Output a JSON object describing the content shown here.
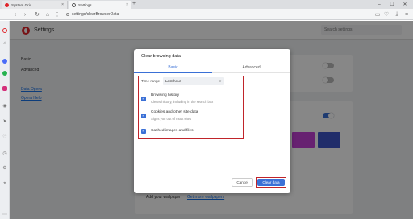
{
  "browser": {
    "tabs": [
      {
        "label": "System Grid"
      },
      {
        "label": "Settings"
      }
    ],
    "new_tab_symbol": "+",
    "url": "settings/clearBrowserData",
    "window_controls": [
      "–",
      "☐",
      "✕"
    ]
  },
  "sidebar_icons": [
    "opera-logo-icon",
    "home-icon",
    "messenger-icon",
    "whatsapp-icon",
    "instagram-icon",
    "camera-icon",
    "send-icon",
    "heart-icon",
    "history-icon",
    "settings-icon",
    "pin-icon"
  ],
  "settings_page": {
    "title": "Settings",
    "search_placeholder": "Search settings",
    "nav": {
      "basic": "Basic",
      "advanced": "Advanced",
      "privacy": "Data Opera",
      "help": "Opera Help"
    },
    "wallpaper_text": "Add your wallpaper",
    "wallpaper_link": "Get more wallpapers"
  },
  "dialog": {
    "title": "Clear browsing data",
    "tabs": {
      "basic": "Basic",
      "advanced": "Advanced"
    },
    "time_range_label": "Time range",
    "time_range_value": "Last hour",
    "options": [
      {
        "title": "Browsing history",
        "desc": "Clears history, including in the search box",
        "checked": true
      },
      {
        "title": "Cookies and other site data",
        "desc": "Signs you out of most sites",
        "checked": true
      },
      {
        "title": "Cached images and files",
        "desc": "",
        "checked": true
      }
    ],
    "cancel_label": "Cancel",
    "clear_label": "Clear data"
  },
  "colors": {
    "accent": "#3a70d6",
    "highlight": "#c0242a",
    "opera_red": "#e0242a"
  }
}
